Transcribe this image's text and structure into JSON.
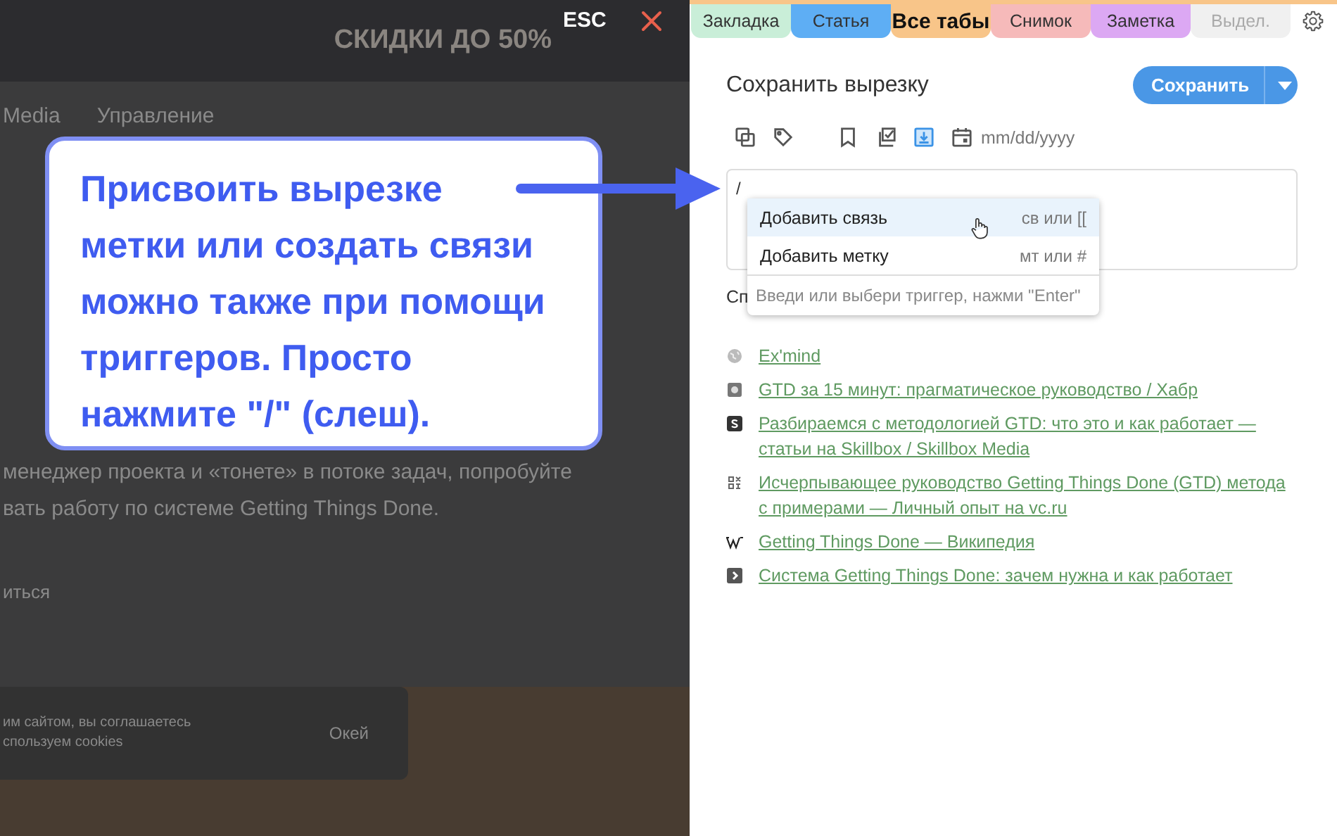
{
  "background_page": {
    "banner": "СКИДКИ ДО 50%",
    "nav": [
      "Media",
      "Управление"
    ],
    "paragraph": "менеджер проекта и «тонете» в потоке задач, попробуйте\nвать работу по системе Getting Things Done.",
    "link": "иться",
    "cookie_text": "им сайтом, вы соглашаетесь\nспользуем cookies",
    "cookie_button": "Окей"
  },
  "overlay": {
    "esc": "ESC"
  },
  "callout": {
    "text": "Присвоить вырезке\nметки или создать связи\nможно также при помощи\nтриггеров. Просто\nнажмите \"/\" (слеш)."
  },
  "tabs": [
    {
      "label": "Закладка",
      "color": "#c9eed8",
      "selected": false,
      "disabled": false
    },
    {
      "label": "Статья",
      "color": "#5eaef4",
      "selected": false,
      "disabled": false
    },
    {
      "label": "Все табы",
      "color": "#f8c589",
      "selected": true,
      "disabled": false
    },
    {
      "label": "Снимок",
      "color": "#f6baba",
      "selected": false,
      "disabled": false
    },
    {
      "label": "Заметка",
      "color": "#dca8f3",
      "selected": false,
      "disabled": false
    },
    {
      "label": "Выдел.",
      "color": "#f0f0f0",
      "selected": false,
      "disabled": true
    }
  ],
  "title": "Сохранить вырезку",
  "save_button": "Сохранить",
  "toolbar": [
    {
      "kind": "copy",
      "selected": false
    },
    {
      "kind": "tag",
      "selected": false
    },
    {
      "kind": "bookmark",
      "selected": false
    },
    {
      "kind": "checklist",
      "selected": false
    },
    {
      "kind": "download",
      "selected": true
    },
    {
      "kind": "calendar",
      "selected": false
    }
  ],
  "date_field": {
    "placeholder": "mm/dd/yyyy"
  },
  "editor": {
    "value": "/"
  },
  "trigger_menu": {
    "items": [
      {
        "label": "Добавить связь",
        "shortcut": "св или [[",
        "selected": true
      },
      {
        "label": "Добавить метку",
        "shortcut": "мт или #",
        "selected": false
      }
    ],
    "hint": "Введи или выбери триггер, нажми \"Enter\""
  },
  "section_label": "Сп",
  "links": [
    {
      "kind": "globe",
      "title": "Ex'mind"
    },
    {
      "kind": "square",
      "title": "GTD за 15 минут: прагматическое руководство / Хабр"
    },
    {
      "kind": "letter",
      "title": "Разбираемся с методологией GTD: что это и как работает — статьи на Skillbox / Skillbox Media"
    },
    {
      "kind": "glyph",
      "title": "Исчерпывающее руководство Getting Things Done (GTD) метода с примерами — Личный опыт на vc.ru"
    },
    {
      "kind": "wiki",
      "title": "Getting Things Done — Википедия"
    },
    {
      "kind": "chevron",
      "title": "Система Getting Things Done: зачем нужна и как работает"
    }
  ]
}
